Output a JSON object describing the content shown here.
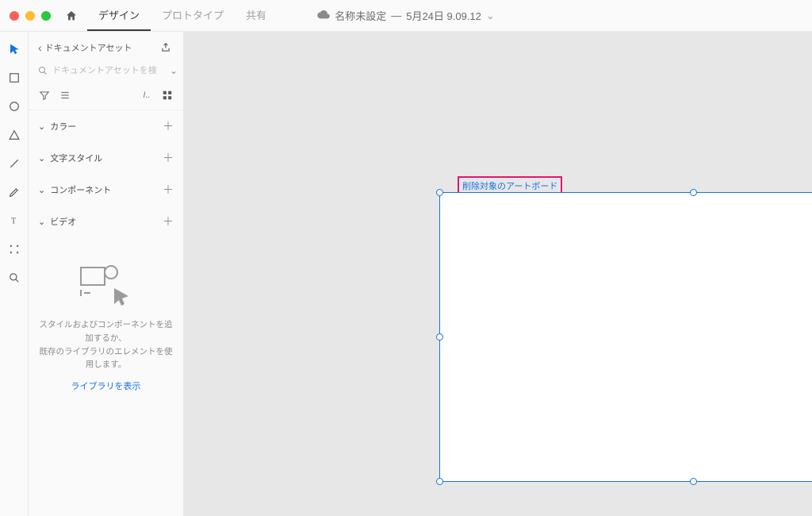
{
  "titlebar": {
    "tabs": {
      "design": "デザイン",
      "prototype": "プロトタイプ",
      "share": "共有"
    },
    "doc_status": "名称未設定",
    "doc_sep": "—",
    "doc_time": "5月24日 9.09.12"
  },
  "sidebar": {
    "back_label": "ドキュメントアセット",
    "search_placeholder": "ドキュメントアセットを検",
    "sections": {
      "color": "カラー",
      "text_styles": "文字スタイル",
      "components": "コンポーネント",
      "video": "ビデオ"
    },
    "empty_line1": "スタイルおよびコンポーネントを追加するか、",
    "empty_line2": "既存のライブラリのエレメントを使用します。",
    "library_link": "ライブラリを表示"
  },
  "canvas": {
    "artboard_label": "削除対象のアートボード"
  },
  "colors": {
    "accent": "#1673e6",
    "highlight_border": "#e3166f"
  }
}
